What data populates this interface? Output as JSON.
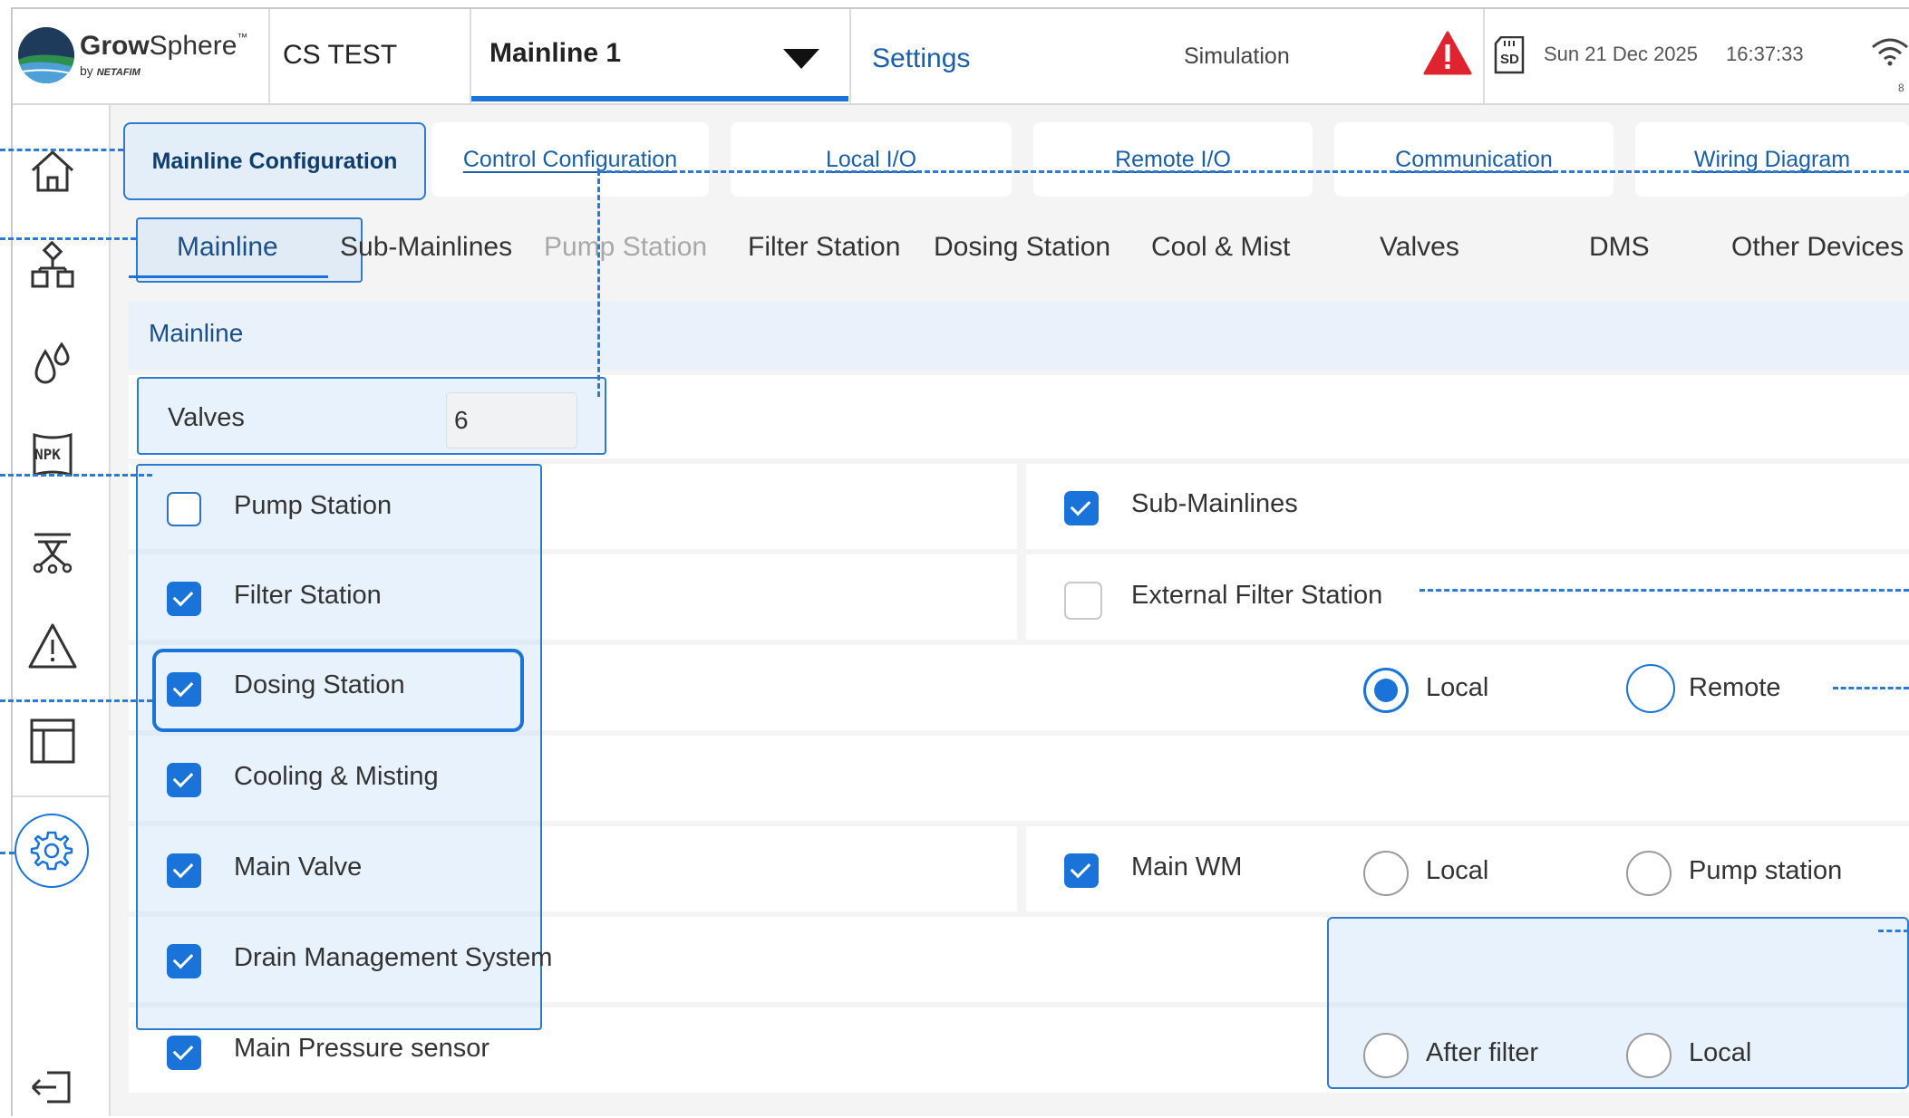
{
  "header": {
    "brand_name_bold": "Grow",
    "brand_name_rest": "Sphere",
    "brand_tm": "™",
    "brand_by": "by",
    "brand_sub": "NETAFIM",
    "site_name": "CS TEST",
    "mainline_selector": "Mainline 1",
    "settings_label": "Settings",
    "mode_label": "Simulation",
    "sd_label": "SD",
    "date": "Sun 21 Dec 2025",
    "time": "16:37:33",
    "signal_value": "8"
  },
  "sidebar": {
    "items": [
      {
        "icon": "home-icon"
      },
      {
        "icon": "hierarchy-icon"
      },
      {
        "icon": "water-drops-icon"
      },
      {
        "icon": "npk-icon",
        "label": "NPK"
      },
      {
        "icon": "sprinkler-icon"
      },
      {
        "icon": "alarm-icon"
      },
      {
        "icon": "table-layout-icon"
      },
      {
        "icon": "settings-gear-icon"
      },
      {
        "icon": "logout-icon"
      }
    ]
  },
  "config_tabs": [
    {
      "label": "Mainline Configuration",
      "active": true
    },
    {
      "label": "Control Configuration"
    },
    {
      "label": "Local I/O"
    },
    {
      "label": "Remote  I/O"
    },
    {
      "label": "Communication"
    },
    {
      "label": "Wiring Diagram"
    }
  ],
  "sub_tabs": [
    {
      "label": "Mainline",
      "active": true
    },
    {
      "label": "Sub-Mainlines"
    },
    {
      "label": "Pump Station",
      "disabled": true
    },
    {
      "label": "Filter Station"
    },
    {
      "label": "Dosing Station"
    },
    {
      "label": "Cool & Mist"
    },
    {
      "label": "Valves"
    },
    {
      "label": "DMS"
    },
    {
      "label": "Other Devices"
    }
  ],
  "section": {
    "title": "Mainline",
    "valves_label": "Valves",
    "valves_value": "6"
  },
  "left_options": [
    {
      "label": "Pump Station",
      "checked": false
    },
    {
      "label": "Filter Station",
      "checked": true
    },
    {
      "label": "Dosing Station",
      "checked": true
    },
    {
      "label": "Cooling & Misting",
      "checked": true
    },
    {
      "label": "Main Valve",
      "checked": true
    },
    {
      "label": "Drain Management System",
      "checked": true
    },
    {
      "label": "Main Pressure sensor",
      "checked": true
    }
  ],
  "right_options": {
    "sub_mainlines": {
      "label": "Sub-Mainlines",
      "checked": true
    },
    "external_filter": {
      "label": "External Filter Station",
      "checked": false
    },
    "dosing_local": "Local",
    "dosing_remote": "Remote",
    "main_wm": {
      "label": "Main WM",
      "checked": true
    },
    "wm_local": "Local",
    "wm_pump_station": "Pump station",
    "pressure_after_filter": "After filter",
    "pressure_local": "Local"
  },
  "colors": {
    "accent": "#1a73d9",
    "highlight": "#2e7ad1",
    "alert": "#e0242f"
  }
}
